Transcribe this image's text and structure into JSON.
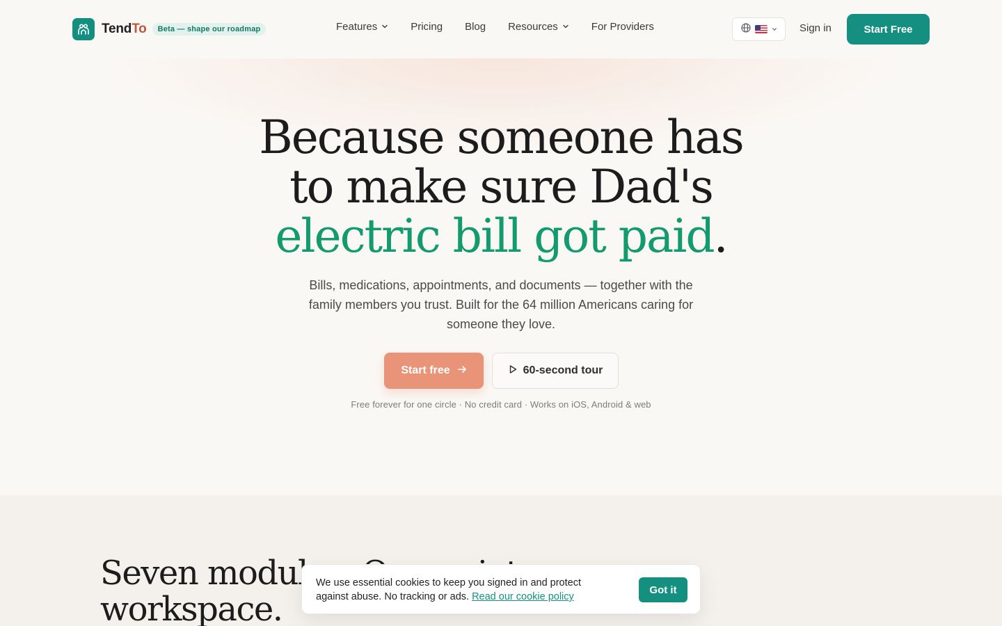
{
  "brand": {
    "name_part1": "Tend",
    "name_part2": "To",
    "beta_badge": "Beta — shape our roadmap",
    "accent_color": "#148f80",
    "secondary_accent": "#c0573a"
  },
  "nav": {
    "items": [
      {
        "label": "Features",
        "has_dropdown": true
      },
      {
        "label": "Pricing",
        "has_dropdown": false
      },
      {
        "label": "Blog",
        "has_dropdown": false
      },
      {
        "label": "Resources",
        "has_dropdown": true
      },
      {
        "label": "For Providers",
        "has_dropdown": false
      }
    ],
    "language_icon": "globe-icon",
    "language_flag": "us-flag-icon",
    "sign_in_label": "Sign in",
    "start_free_label": "Start Free"
  },
  "hero": {
    "title_line1": "Because someone has",
    "title_line2": "to make sure Dad's",
    "title_accent": "electric bill got paid",
    "title_period": ".",
    "subtitle": "Bills, medications, appointments, and documents — together with the family members you trust. Built for the 64 million Americans caring for someone they love.",
    "cta_primary_label": "Start free",
    "cta_secondary_label": "60-second tour",
    "fine_print": "Free forever for one circle · No credit card · Works on iOS, Android & web"
  },
  "modules_section": {
    "title": "Seven modules. One quiet workspace."
  },
  "cookie_banner": {
    "text": "We use essential cookies to keep you signed in and protect against abuse. No tracking or ads.",
    "link_label": "Read our cookie policy",
    "button_label": "Got it"
  }
}
